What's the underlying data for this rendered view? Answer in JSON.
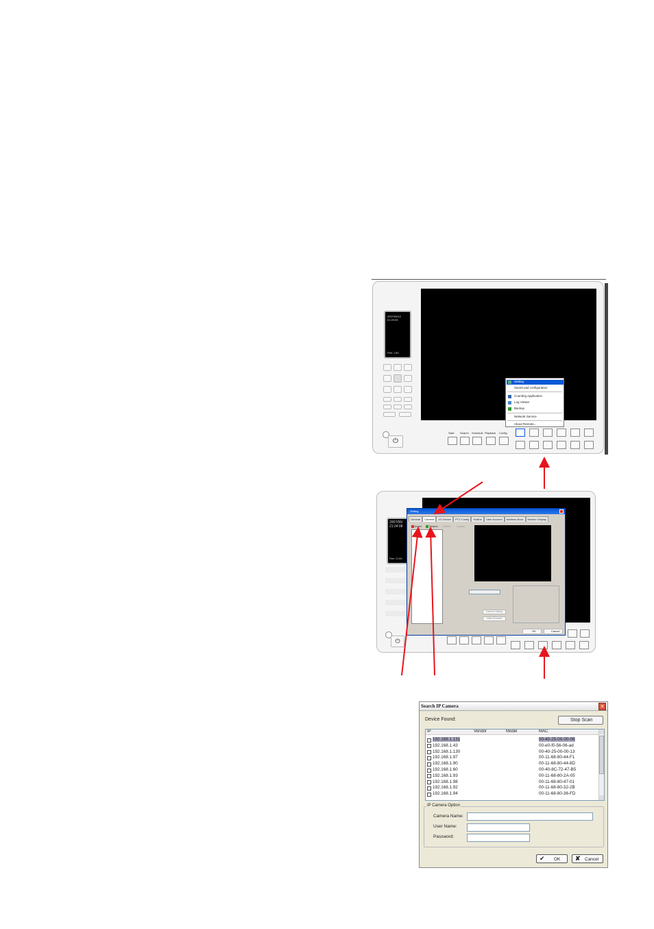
{
  "main_screen": {
    "clock": "2007/06/12\n01:25:05",
    "clock_footer": "Free: 1.5G",
    "toolbar_labels": [
      "Start",
      "Search",
      "Schedule",
      "Playback",
      "Config"
    ],
    "context_menu": [
      "Setting",
      "Save/Load configuration",
      "Counting Application",
      "Log Viewer",
      "Backup",
      "Network Service",
      "About Remote..."
    ]
  },
  "setting_screen": {
    "clock": "2007/06/\n21:24:08",
    "clock_footer": "Free: 21.6G",
    "window_title": "Setting",
    "tabs": [
      "General",
      "Camera",
      "I/O Device",
      "PTZ Config",
      "Hotline",
      "User Account",
      "Address Book",
      "Monitor Display"
    ],
    "toolbar": [
      "Insert",
      "Search",
      "Delete",
      "Config"
    ],
    "buttons": [
      "Camera Setting",
      "Video Encoder"
    ],
    "ok": "OK",
    "cancel": "Cancel"
  },
  "search_dialog": {
    "title": "Search IP Camera",
    "device_found_label": "Device Found:",
    "stop_scan_label": "Stop Scan",
    "columns": [
      "IP",
      "Vendor",
      "Model",
      "MAC"
    ],
    "devices": [
      {
        "ip": "192.168.1.131",
        "mac": "00-40-25-00-00-06",
        "selected": true
      },
      {
        "ip": "192.168.1.43",
        "mac": "00-e0-f0-56-06-ad",
        "selected": false
      },
      {
        "ip": "192.168.1.130",
        "mac": "00-40-25-00-00-13",
        "selected": false
      },
      {
        "ip": "192.168.1.97",
        "mac": "00-11-68-80-44-F1",
        "selected": false
      },
      {
        "ip": "192.168.1.90",
        "mac": "00-11-68-80-44-8D",
        "selected": false
      },
      {
        "ip": "192.168.1.60",
        "mac": "00-40-8C-72-47-B5",
        "selected": false
      },
      {
        "ip": "192.168.1.93",
        "mac": "00-11-68-80-2A-05",
        "selected": false
      },
      {
        "ip": "192.168.1.98",
        "mac": "00-11-68-80-47-01",
        "selected": false
      },
      {
        "ip": "192.168.1.92",
        "mac": "00-11-68-80-32-2B",
        "selected": false
      },
      {
        "ip": "192.168.1.94",
        "mac": "00-11-68-80-36-FD",
        "selected": false
      }
    ],
    "option_group_label": "IP Camera Option",
    "camera_name_label": "Camera Name:",
    "user_name_label": "User Name:",
    "password_label": "Password:",
    "ok_label": "OK",
    "cancel_label": "Cancel"
  },
  "colors": {
    "arrow": "#e8141c",
    "highlight": "#0a58d6",
    "selected_row": "#a8a8c0"
  }
}
